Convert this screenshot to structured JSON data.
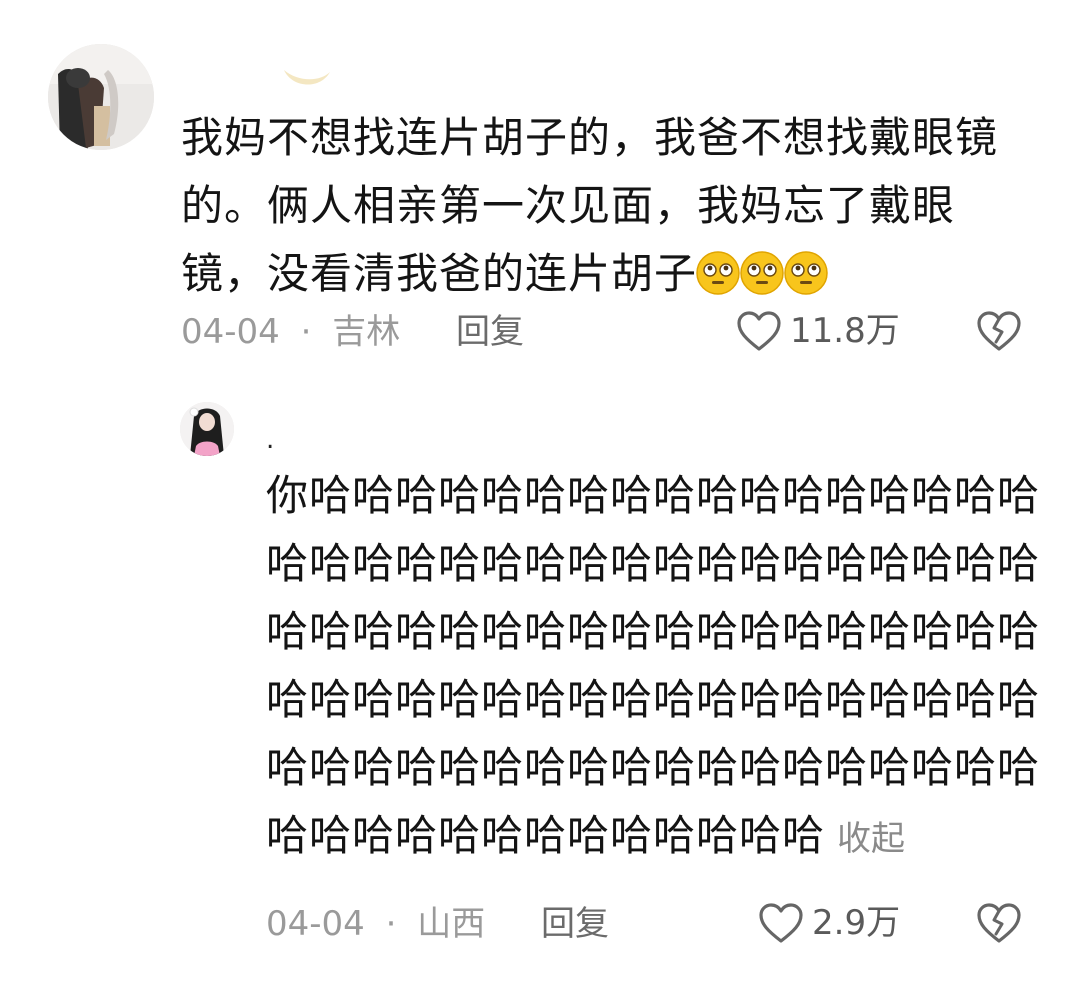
{
  "comments": [
    {
      "text": "我妈不想找连片胡子的，我爸不想找戴眼镜的。俩人相亲第一次见面，我妈忘了戴眼镜，没看清我爸的连片胡子",
      "emoji_icon": "flushed-face-emoji",
      "emoji_count": 3,
      "date": "04-04",
      "separator": "·",
      "location": "吉林",
      "reply_label": "回复",
      "like_count": "11.8万",
      "like_icon": "heart-outline-icon",
      "dislike_icon": "broken-heart-icon"
    },
    {
      "username": ".",
      "text": "你哈哈哈哈哈哈哈哈哈哈哈哈哈哈哈哈哈哈哈哈哈哈哈哈哈哈哈哈哈哈哈哈哈哈哈哈哈哈哈哈哈哈哈哈哈哈哈哈哈哈哈哈哈哈哈哈哈哈哈哈哈哈哈哈哈哈哈哈哈哈哈哈哈哈哈哈哈哈哈哈哈哈哈哈哈哈哈哈哈哈哈哈哈哈哈哈哈哈哈哈哈哈",
      "collapse_label": "收起",
      "date": "04-04",
      "separator": "·",
      "location": "山西",
      "reply_label": "回复",
      "like_count": "2.9万",
      "like_icon": "heart-outline-icon",
      "dislike_icon": "broken-heart-icon"
    }
  ],
  "colors": {
    "text": "#141414",
    "meta": "#9a9a9a",
    "reply": "#6b6b6b",
    "emoji_face": "#f8c51c"
  }
}
